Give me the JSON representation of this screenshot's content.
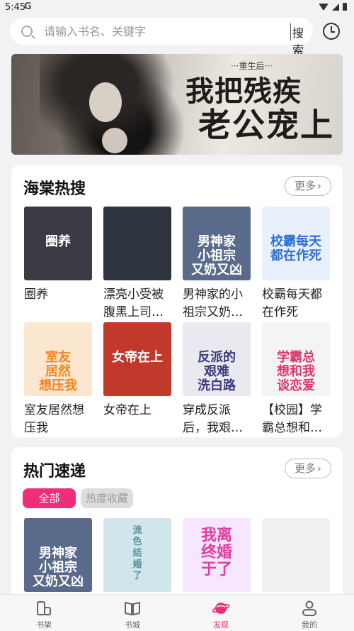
{
  "status_bar": {
    "time": "5:45",
    "g_label": "G"
  },
  "search": {
    "placeholder": "请输入书名、关键字",
    "button_label": "搜索"
  },
  "banner": {
    "subtitle": "···重生后···",
    "title_line1": "我把残疾",
    "title_line2": "老公宠上"
  },
  "hot_section": {
    "title": "海棠热搜",
    "more_label": "更多",
    "books": [
      {
        "title": "圈养",
        "cover_text": "圈养",
        "cover_bg": "#3a3b44",
        "cover_fg": "#ffffff"
      },
      {
        "title": "漂亮小受被腹黑上司…",
        "cover_text": "",
        "cover_bg": "#2e3340",
        "cover_fg": "#ffffff"
      },
      {
        "title": "男神家的小祖宗又奶…",
        "cover_text": "男神家\n小祖宗\n又奶又凶",
        "cover_bg": "#5a6a8a",
        "cover_fg": "#ffffff"
      },
      {
        "title": "校霸每天都在作死",
        "cover_text": "校霸每天\n都在作死",
        "cover_bg": "#e8f1fb",
        "cover_fg": "#2f6fd6"
      },
      {
        "title": "室友居然想压我",
        "cover_text": "室友\n居然\n想压我",
        "cover_bg": "#fbe6cf",
        "cover_fg": "#f2851f"
      },
      {
        "title": "女帝在上",
        "cover_text": "女帝在上",
        "cover_bg": "#c0392b",
        "cover_fg": "#ffffff"
      },
      {
        "title": "穿成反派后，我艰…",
        "cover_text": "反派的\n艰难\n洗白路",
        "cover_bg": "#e9e9ef",
        "cover_fg": "#3b3b7a"
      },
      {
        "title": "【校园】学霸总想和…",
        "cover_text": "学霸总\n想和我\n谈恋爱",
        "cover_bg": "#f4f4f4",
        "cover_fg": "#d93a6a"
      }
    ]
  },
  "express_section": {
    "title": "热门速递",
    "more_label": "更多",
    "tabs": [
      {
        "label": "全部",
        "active": true
      },
      {
        "label": "热度收藏",
        "active": false
      }
    ],
    "books": [
      {
        "cover_text": "男神家\n小祖宗\n又奶又凶",
        "cover_bg": "#5a6a8a",
        "cover_fg": "#ffffff"
      },
      {
        "cover_text": "流\n色\n结\n婚\n了",
        "cover_bg": "#cfe6ea",
        "cover_fg": "#5c8f9c"
      },
      {
        "cover_text": "我离\n终婚\n于了",
        "cover_bg": "#f6e6ff",
        "cover_fg": "#e23d9e"
      },
      {
        "cover_text": "",
        "cover_bg": "#f0f0f0",
        "cover_fg": "#333333"
      }
    ]
  },
  "bottom_nav": [
    {
      "label": "书架",
      "icon": "bookshelf-icon",
      "active": false
    },
    {
      "label": "书城",
      "icon": "book-open-icon",
      "active": false
    },
    {
      "label": "发现",
      "icon": "planet-icon",
      "active": true
    },
    {
      "label": "我的",
      "icon": "person-icon",
      "active": false
    }
  ],
  "colors": {
    "accent": "#ef2d78",
    "background": "#f2f2f4"
  }
}
